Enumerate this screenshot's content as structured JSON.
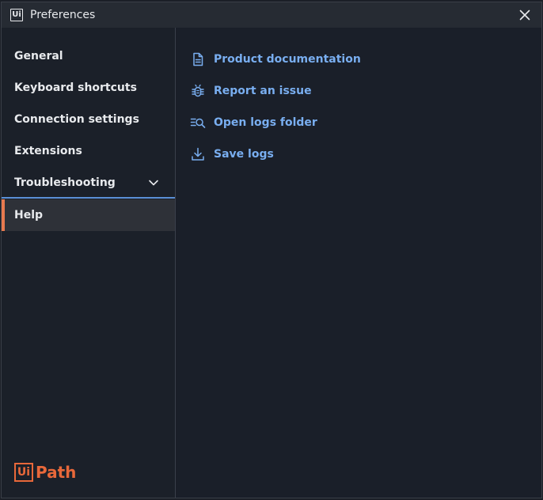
{
  "window": {
    "title": "Preferences",
    "title_logo": "Ui"
  },
  "sidebar": {
    "items": [
      {
        "label": "General"
      },
      {
        "label": "Keyboard shortcuts"
      },
      {
        "label": "Connection settings"
      },
      {
        "label": "Extensions"
      },
      {
        "label": "Troubleshooting",
        "expandable": true
      },
      {
        "label": "Help",
        "active": true
      }
    ]
  },
  "brand": {
    "box": "Ui",
    "text": "Path",
    "color": "#e8683a"
  },
  "help": {
    "links": [
      {
        "label": "Product documentation",
        "icon": "document-icon"
      },
      {
        "label": "Report an issue",
        "icon": "bug-icon"
      },
      {
        "label": "Open logs folder",
        "icon": "search-list-icon"
      },
      {
        "label": "Save logs",
        "icon": "download-icon"
      }
    ]
  },
  "colors": {
    "accent": "#e87a4f",
    "link": "#79aef0",
    "divider": "#5a8fd6"
  }
}
